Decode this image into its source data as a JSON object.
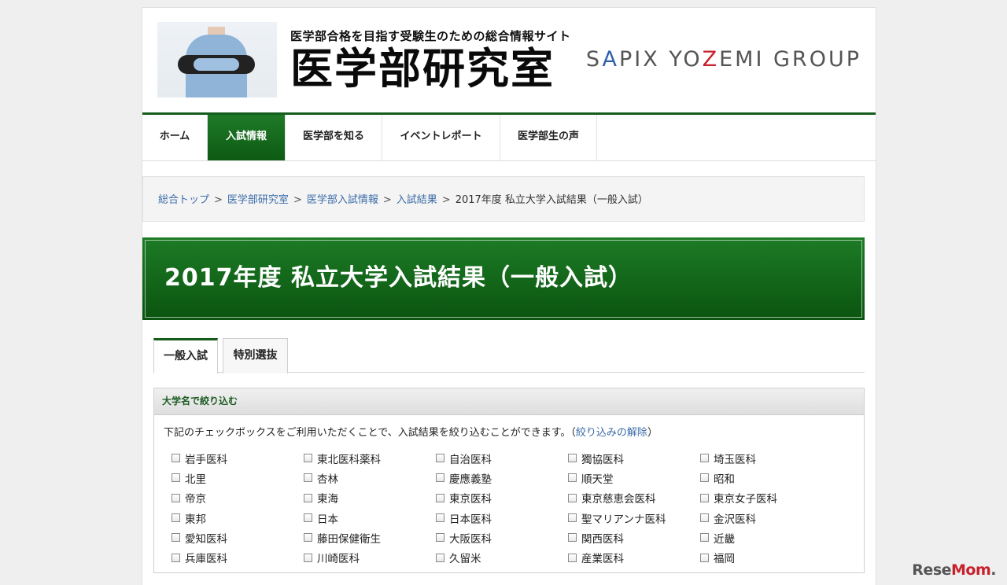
{
  "header": {
    "tagline": "医学部合格を目指す受験生のための総合情報サイト",
    "site_title": "医学部研究室",
    "brand": {
      "S": "S",
      "A": "A",
      "rest1": "PIX YO",
      "Z": "Z",
      "rest2": "EMI GROUP"
    }
  },
  "nav": {
    "items": [
      {
        "label": "ホーム"
      },
      {
        "label": "入試情報"
      },
      {
        "label": "医学部を知る"
      },
      {
        "label": "イベントレポート"
      },
      {
        "label": "医学部生の声"
      }
    ],
    "active_index": 1
  },
  "breadcrumb": {
    "links": [
      "総合トップ",
      "医学部研究室",
      "医学部入試情報",
      "入試結果"
    ],
    "separator": ">",
    "current": "2017年度 私立大学入試結果（一般入試）"
  },
  "page_title": "2017年度 私立大学入試結果（一般入試）",
  "tabs": [
    {
      "label": "一般入試",
      "active": true
    },
    {
      "label": "特別選抜",
      "active": false
    }
  ],
  "filter": {
    "heading": "大学名で絞り込む",
    "description": "下記のチェックボックスをご利用いただくことで、入試結果を絞り込むことができます。",
    "reset_open": "（",
    "reset_link": "絞り込みの解除",
    "reset_close": "）",
    "universities": [
      "岩手医科",
      "東北医科薬科",
      "自治医科",
      "獨協医科",
      "埼玉医科",
      "北里",
      "杏林",
      "慶應義塾",
      "順天堂",
      "昭和",
      "帝京",
      "東海",
      "東京医科",
      "東京慈恵会医科",
      "東京女子医科",
      "東邦",
      "日本",
      "日本医科",
      "聖マリアンナ医科",
      "金沢医科",
      "愛知医科",
      "藤田保健衛生",
      "大阪医科",
      "関西医科",
      "近畿",
      "兵庫医科",
      "川崎医科",
      "久留米",
      "産業医科",
      "福岡"
    ]
  },
  "watermark": {
    "a": "Rese",
    "b": "Mom",
    "c": "."
  },
  "colors": {
    "nav_active": "#155c1d",
    "banner": "#0d5a14",
    "link": "#3b6ca8"
  }
}
